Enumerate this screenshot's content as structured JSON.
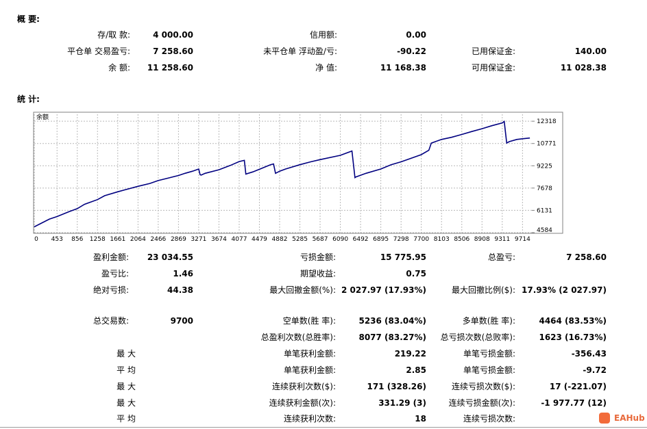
{
  "summary": {
    "title": "概 要:",
    "deposit_label": "存/取 款:",
    "deposit_value": "4 000.00",
    "credit_label": "信用额:",
    "credit_value": "0.00",
    "closed_pl_label": "平仓单 交易盈亏:",
    "closed_pl_value": "7 258.60",
    "floating_pl_label": "未平仓单 浮动盈/亏:",
    "floating_pl_value": "-90.22",
    "margin_label": "已用保证金:",
    "margin_value": "140.00",
    "balance_label": "余 额:",
    "balance_value": "11 258.60",
    "equity_label": "净 值:",
    "equity_value": "11 168.38",
    "free_margin_label": "可用保证金:",
    "free_margin_value": "11 028.38"
  },
  "stats_title": "统 计:",
  "chart_data": {
    "type": "line",
    "title": "余额",
    "x": [
      0,
      120,
      300,
      453,
      700,
      856,
      1000,
      1258,
      1400,
      1661,
      1800,
      2064,
      2300,
      2466,
      2700,
      2869,
      3000,
      3150,
      3271,
      3300,
      3320,
      3400,
      3674,
      3900,
      4077,
      4180,
      4210,
      4350,
      4479,
      4700,
      4760,
      4800,
      4882,
      5000,
      5285,
      5500,
      5687,
      6090,
      6320,
      6380,
      6400,
      6600,
      6895,
      7100,
      7298,
      7500,
      7700,
      7850,
      7900,
      8103,
      8300,
      8506,
      8700,
      8908,
      9100,
      9311,
      9350,
      9400,
      9450,
      9600,
      9714,
      9860
    ],
    "y": [
      4990,
      5200,
      5520,
      5700,
      6050,
      6250,
      6550,
      6880,
      7150,
      7420,
      7550,
      7800,
      8000,
      8200,
      8400,
      8550,
      8700,
      8850,
      9000,
      8600,
      8580,
      8700,
      8950,
      9250,
      9520,
      9600,
      8650,
      8800,
      8980,
      9300,
      9350,
      8700,
      8850,
      9000,
      9300,
      9500,
      9650,
      9950,
      10250,
      8400,
      8450,
      8700,
      9000,
      9300,
      9500,
      9750,
      10000,
      10300,
      10800,
      11050,
      11200,
      11400,
      11600,
      11800,
      12000,
      12200,
      12300,
      10800,
      10900,
      11050,
      11100,
      11150
    ],
    "ytick_labels": [
      "12318",
      "10771",
      "9225",
      "7678",
      "6131",
      "4584"
    ],
    "ytick_values": [
      12318,
      10771,
      9225,
      7678,
      6131,
      4584
    ],
    "xtick_labels": [
      "0",
      "453",
      "856",
      "1258",
      "1661",
      "2064",
      "2466",
      "2869",
      "3271",
      "3674",
      "4077",
      "4479",
      "4882",
      "5285",
      "5687",
      "6090",
      "6492",
      "6895",
      "7298",
      "7700",
      "8103",
      "8506",
      "8908",
      "9311",
      "9714"
    ],
    "xtick_values": [
      0,
      453,
      856,
      1258,
      1661,
      2064,
      2466,
      2869,
      3271,
      3674,
      4077,
      4479,
      4882,
      5285,
      5687,
      6090,
      6492,
      6895,
      7298,
      7700,
      8103,
      8506,
      8908,
      9311,
      9714
    ],
    "xlim": [
      0,
      9900
    ],
    "ylim": [
      4584,
      12800
    ],
    "grid": true,
    "line_color": "#000080"
  },
  "stats": {
    "gross_profit_label": "盈利金额:",
    "gross_profit_value": "23 034.55",
    "gross_loss_label": "亏损金额:",
    "gross_loss_value": "15 775.95",
    "net_profit_label": "总盈亏:",
    "net_profit_value": "7 258.60",
    "profit_factor_label": "盈亏比:",
    "profit_factor_value": "1.46",
    "expected_payoff_label": "期望收益:",
    "expected_payoff_value": "0.75",
    "abs_drawdown_label": "绝对亏损:",
    "abs_drawdown_value": "44.38",
    "max_dd_label": "最大回撤金额(%):",
    "max_dd_value": "2 027.97 (17.93%)",
    "rel_dd_label": "最大回撤比例($):",
    "rel_dd_value": "17.93% (2 027.97)",
    "total_trades_label": "总交易数:",
    "total_trades_value": "9700",
    "short_label": "空单数(胜 率):",
    "short_value": "5236 (83.04%)",
    "long_label": "多单数(胜 率):",
    "long_value": "4464 (83.53%)",
    "profit_trades_label": "总盈利次数(总胜率):",
    "profit_trades_value": "8077 (83.27%)",
    "loss_trades_label": "总亏损次数(总败率):",
    "loss_trades_value": "1623 (16.73%)",
    "max1_label": "最 大",
    "largest_profit_label": "单笔获利金额:",
    "largest_profit_value": "219.22",
    "largest_loss_label": "单笔亏损金额:",
    "largest_loss_value": "-356.43",
    "avg1_label": "平 均",
    "avg_profit_label": "单笔获利金额:",
    "avg_profit_value": "2.85",
    "avg_loss_label": "单笔亏损金额:",
    "avg_loss_value": "-9.72",
    "max2_label": "最 大",
    "max_consec_wins_label": "连续获利次数($):",
    "max_consec_wins_value": "171 (328.26)",
    "max_consec_losses_label": "连续亏损次数($):",
    "max_consec_losses_value": "17 (-221.07)",
    "max3_label": "最 大",
    "max_consec_profit_label": "连续获利金额(次):",
    "max_consec_profit_value": "331.29 (3)",
    "max_consec_loss_label": "连续亏损金额(次):",
    "max_consec_loss_value": "-1 977.77 (12)",
    "avg2_label": "平 均",
    "avg_consec_wins_label": "连续获利次数:",
    "avg_consec_wins_value": "18",
    "avg_consec_losses_label": "连续亏损次数:"
  },
  "watermark": {
    "text": "EAHub",
    "logo": "ea-hub-logo"
  }
}
